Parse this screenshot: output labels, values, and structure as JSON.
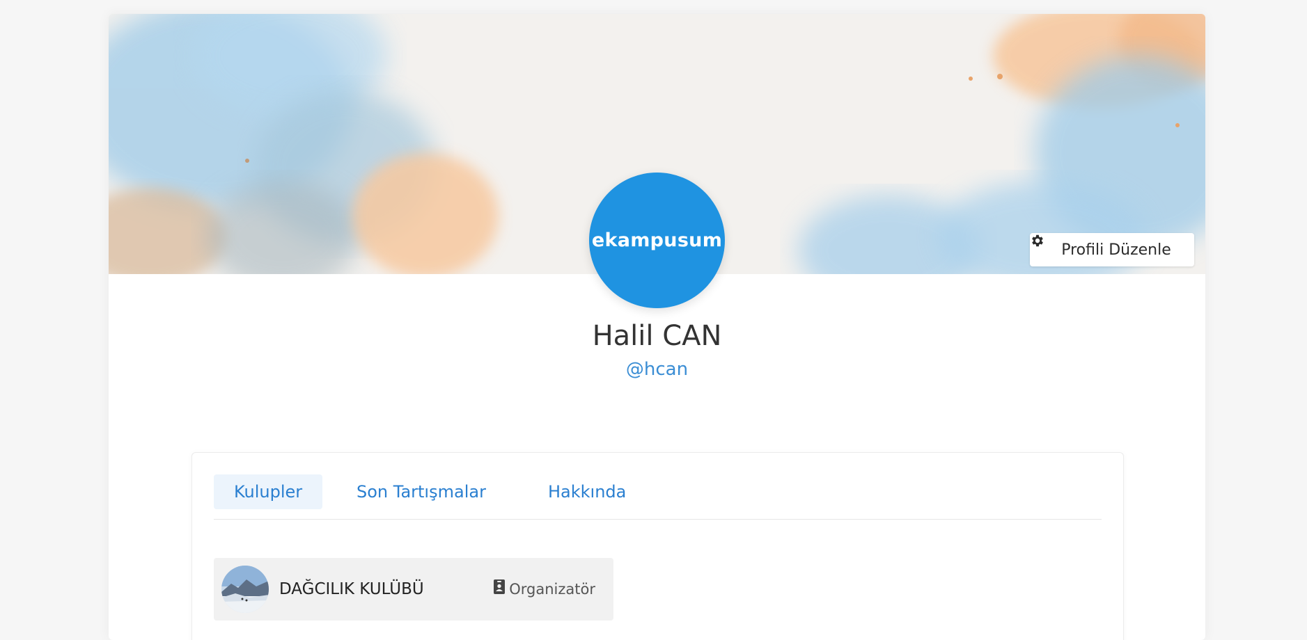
{
  "profile": {
    "edit_button_label": "Profili Düzenle",
    "avatar_logo_text": "ekampusum",
    "name": "Halil CAN",
    "handle": "@hcan"
  },
  "tabs": [
    {
      "label": "Kulupler",
      "active": true
    },
    {
      "label": "Son Tartışmalar",
      "active": false
    },
    {
      "label": "Hakkında",
      "active": false
    }
  ],
  "clubs": [
    {
      "name": "DAĞCILIK KULÜBÜ",
      "role": "Organizatör",
      "role_icon": "id-badge-icon"
    }
  ],
  "colors": {
    "brand_blue": "#1f93e1",
    "link_blue": "#2a7fd0",
    "tab_active_bg": "#ecf4fc"
  }
}
